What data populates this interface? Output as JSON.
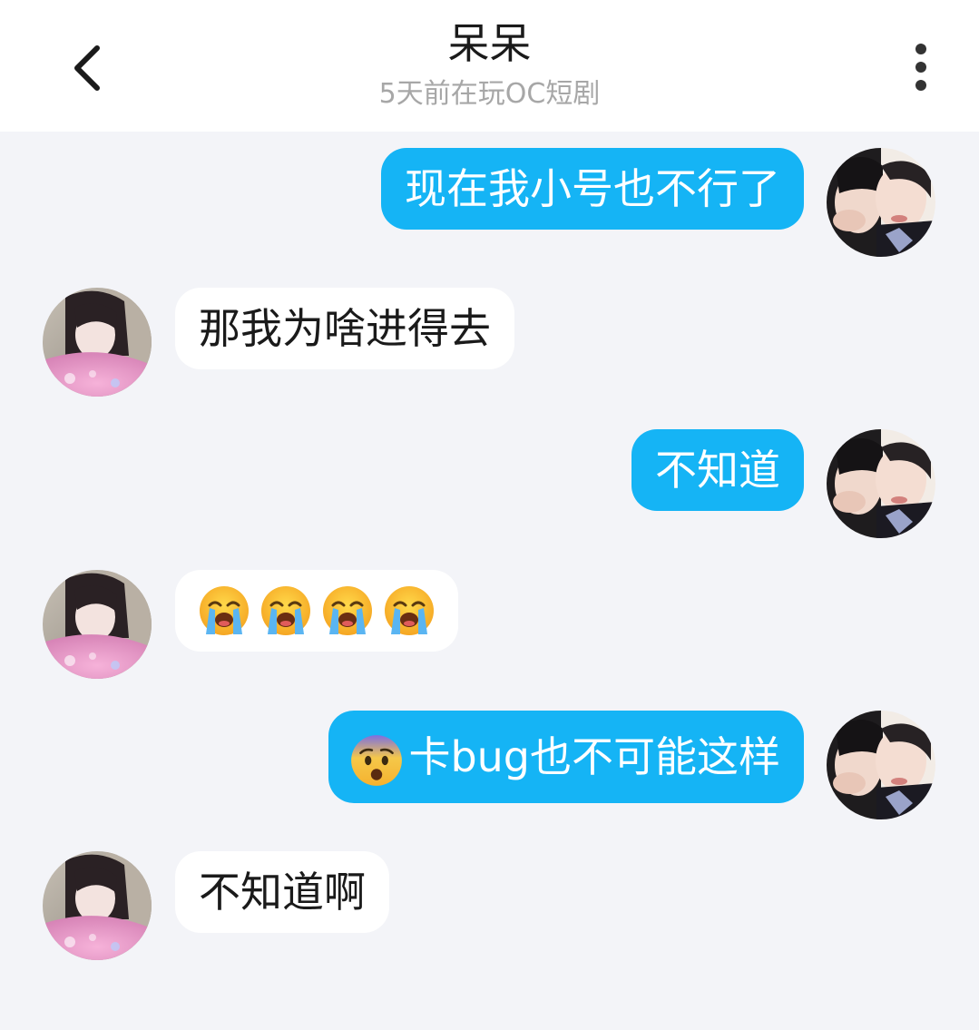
{
  "header": {
    "title": "呆呆",
    "subtitle": "5天前在玩OC短剧",
    "back_icon": "chevron-left-icon",
    "more_icon": "more-vertical-icon"
  },
  "colors": {
    "my_bubble": "#15b4f5",
    "their_bubble": "#ffffff",
    "background": "#f3f4f8"
  },
  "messages": [
    {
      "from": "me",
      "text": "现在我小号也不行了"
    },
    {
      "from": "them",
      "text": "那我为啥进得去"
    },
    {
      "from": "me",
      "text": "不知道"
    },
    {
      "from": "them",
      "emoji": [
        "loudly-crying-face",
        "loudly-crying-face",
        "loudly-crying-face",
        "loudly-crying-face"
      ]
    },
    {
      "from": "me",
      "emoji_prefix": "anxious-face",
      "text": "卡bug也不可能这样"
    },
    {
      "from": "them",
      "text": "不知道啊"
    }
  ]
}
